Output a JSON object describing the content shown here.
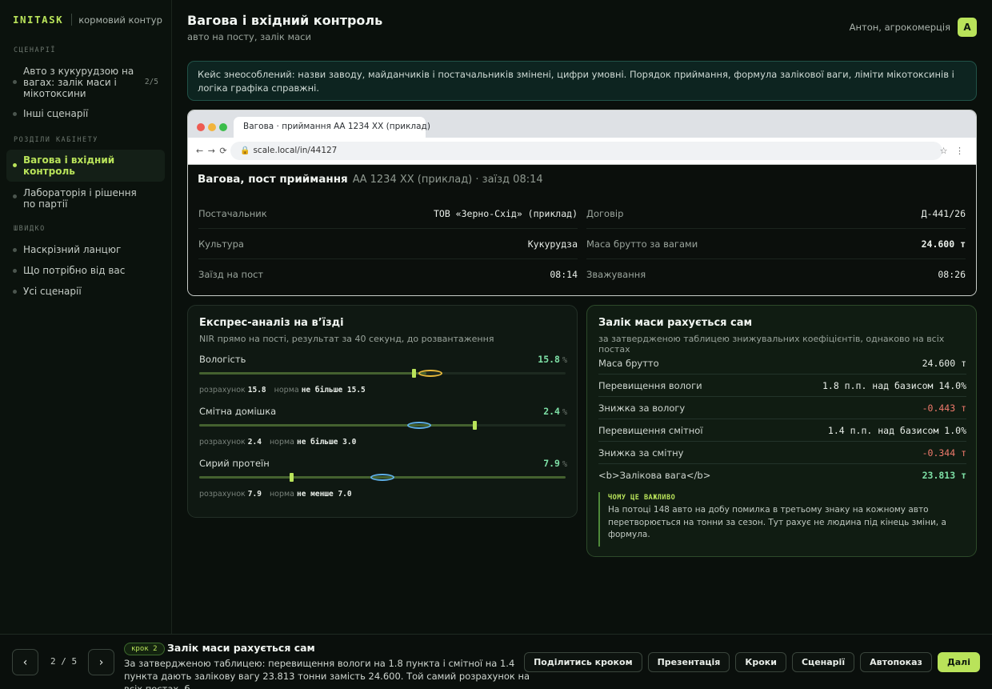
{
  "brand": {
    "name": "INITASK",
    "subtitle": "кормовий контур"
  },
  "sidebar": {
    "sections": [
      {
        "title": "СЦЕНАРІЇ"
      },
      {
        "title": "РОЗДІЛИ КАБІНЕТУ"
      },
      {
        "title": "ШВИДКО"
      }
    ],
    "scenarios": [
      {
        "label": "Авто з кукурудзою на вагах: залік маси і мікотоксини",
        "count": "2/5"
      },
      {
        "label": "Інші сценарії"
      }
    ],
    "cabinet": [
      {
        "label": "Вагова і вхідний контроль",
        "active": true
      },
      {
        "label": "Лабораторія і рішення по партії"
      }
    ],
    "quick": [
      {
        "label": "Наскрізний ланцюг"
      },
      {
        "label": "Що потрібно від вас"
      },
      {
        "label": "Усі сценарії"
      }
    ]
  },
  "header": {
    "title": "Вагова і вхідний контроль",
    "subtitle": "авто на посту, залік маси",
    "user_name": "Антон, агрокомерція",
    "avatar_letter": "А"
  },
  "notice": "Кейс знеособлений: назви заводу, майданчиків і постачальників змінені, цифри умовні. Порядок приймання, формула залікової ваги, ліміти мікотоксинів і логіка графіка справжні.",
  "browser": {
    "tab_title": "Вагова · приймання АА 1234 ХХ (приклад)",
    "nav_glyphs": "← → ⟳",
    "url": "scale.local/in/44127",
    "ext_glyphs": "☆ ⋮",
    "page_title": "Вагова, пост приймання",
    "page_meta": "АА 1234 ХХ (приклад) · заїзд 08:14",
    "fields": [
      {
        "label": "Постачальник",
        "value": "ТОВ «Зерно-Схід» (приклад)"
      },
      {
        "label": "Договір",
        "value": "Д-441/26"
      },
      {
        "label": "Культура",
        "value": "Кукурудза"
      },
      {
        "label": "Маса брутто за вагами",
        "value": "24.600 т"
      },
      {
        "label": "Заїзд на пост",
        "value": "08:14"
      },
      {
        "label": "Зважування",
        "value": "08:26"
      }
    ]
  },
  "express": {
    "title": "Експрес-аналіз на в’їзді",
    "subtitle": "NIR прямо на пості, результат за 40 секунд, до розвантаження",
    "calc_label": "розрахунок",
    "norm_label": "норма",
    "metrics": [
      {
        "label": "Вологість",
        "value": "15.8",
        "unit": "%",
        "calc": "15.8",
        "norm": "не більше 15.5",
        "fill": 0.62,
        "limit": 0.585,
        "marker": 0.63,
        "status": "over"
      },
      {
        "label": "Смітна домішка",
        "value": "2.4",
        "unit": "%",
        "calc": "2.4",
        "norm": "не більше 3.0",
        "fill": 0.75,
        "limit": 0.75,
        "marker": 0.6,
        "status": "ok"
      },
      {
        "label": "Сирий протеїн",
        "value": "7.9",
        "unit": "%",
        "calc": "7.9",
        "norm": "не менше 7.0",
        "fill": 1.0,
        "limit": 0.25,
        "marker": 0.5,
        "status": "ok"
      }
    ]
  },
  "credit": {
    "title": "Залік маси рахується сам",
    "subtitle": "за затвердженою таблицею знижувальних коефіцієнтів, однаково на всіх постах",
    "rows": [
      {
        "label": "Маса брутто",
        "value": "24.600 т",
        "kind": "plain"
      },
      {
        "label": "Перевищення вологи",
        "value": "1.8 п.п. над базисом 14.0%",
        "kind": "plain"
      },
      {
        "label": "Знижка за вологу",
        "value": "-0.443 т",
        "kind": "neg"
      },
      {
        "label": "Перевищення смітної",
        "value": "1.4 п.п. над базисом 1.0%",
        "kind": "plain"
      },
      {
        "label": "Знижка за смітну",
        "value": "-0.344 т",
        "kind": "neg"
      },
      {
        "label": "<b>Залікова вага</b>",
        "value": "23.813 т",
        "kind": "final"
      }
    ],
    "why_title": "ЧОМУ ЦЕ ВАЖЛИВО",
    "why_text": "На потоці 148 авто на добу помилка в третьому знаку на кожному авто перетворюється на тонни за сезон. Тут рахує не людина під кінець зміни, а формула."
  },
  "footer": {
    "prev_glyph": "‹",
    "next_glyph": "›",
    "counter": "2 / 5",
    "step_badge": "крок 2",
    "step_title": "Залік маси рахується сам",
    "step_text": "За затвердженою таблицею: перевищення вологи на 1.8 пункта і смітної на 1.4 пункта дають залікову вагу 23.813 тонни замість 24.600. Той самий розрахунок на всіх постах, б...",
    "actions": [
      "Поділитись кроком",
      "Презентація",
      "Кроки",
      "Сценарії",
      "Автопоказ",
      "Далі"
    ]
  },
  "colors": {
    "accent": "#b9e35a",
    "ok": "#7ee0a6",
    "negative": "#f07a6c",
    "marker_ok": "#5fb0e8",
    "marker_warn": "#e8ba3c"
  }
}
